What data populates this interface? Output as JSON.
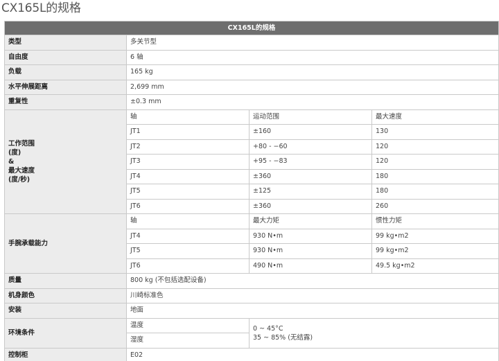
{
  "title": "CX165L的规格",
  "table_header": "CX165L的规格",
  "rows": {
    "type": {
      "label": "类型",
      "value": "多关节型"
    },
    "dof": {
      "label": "自由度",
      "value": "6 轴"
    },
    "payload": {
      "label": "负载",
      "value": "165 kg"
    },
    "reach": {
      "label": "水平伸展距离",
      "value": "2,699 mm"
    },
    "repeat": {
      "label": "重复性",
      "value": "±0.3 mm"
    }
  },
  "motion": {
    "label_lines": [
      "工作范围",
      "(度)",
      "&",
      "最大速度",
      "(度/秒)"
    ],
    "headers": [
      "轴",
      "运动范围",
      "最大速度"
    ],
    "rows": [
      [
        "JT1",
        "±160",
        "130"
      ],
      [
        "JT2",
        "+80 - −60",
        "120"
      ],
      [
        "JT3",
        "+95 - −83",
        "120"
      ],
      [
        "JT4",
        "±360",
        "180"
      ],
      [
        "JT5",
        "±125",
        "180"
      ],
      [
        "JT6",
        "±360",
        "260"
      ]
    ]
  },
  "wrist": {
    "label": "手腕承载能力",
    "headers": [
      "轴",
      "最大力矩",
      "惯性力矩"
    ],
    "rows": [
      [
        "JT4",
        "930 N•m",
        "99 kg•m2"
      ],
      [
        "JT5",
        "930 N•m",
        "99 kg•m2"
      ],
      [
        "JT6",
        "490 N•m",
        "49.5 kg•m2"
      ]
    ]
  },
  "mass": {
    "label": "质量",
    "value": "800 kg (不包括选配设备)"
  },
  "color": {
    "label": "机身颜色",
    "value": "川崎标准色"
  },
  "install": {
    "label": "安装",
    "value": "地面"
  },
  "env": {
    "label": "环境条件",
    "temp_label": "温度",
    "humidity_label": "湿度",
    "temp_value": "0 ~ 45°C",
    "humidity_value": "35 ~ 85% (无结露)"
  },
  "controller": {
    "label": "控制柜",
    "value": "E02"
  }
}
